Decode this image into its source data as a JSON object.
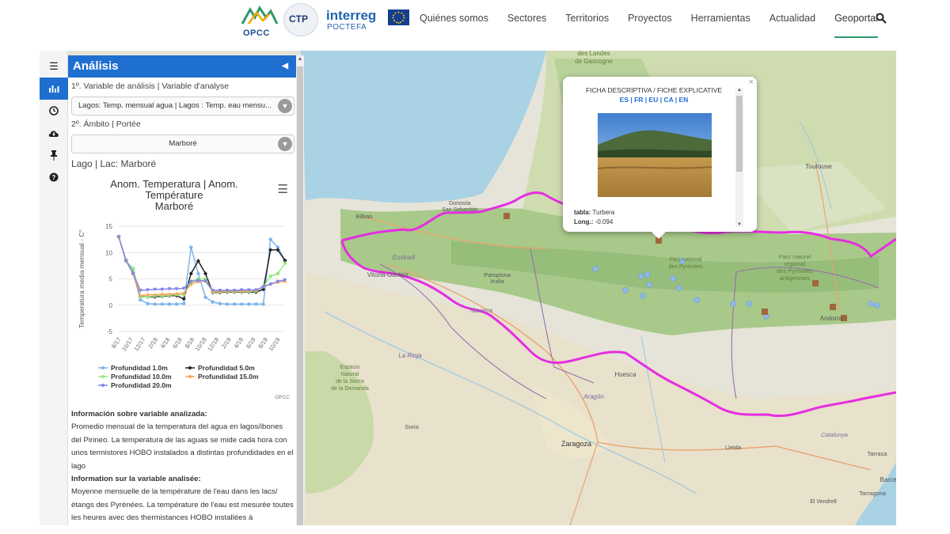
{
  "header": {
    "logos": {
      "opcc": "OPCC",
      "ctp": "CTP",
      "interreg": "interreg",
      "poctefa": "POCTEFA"
    },
    "nav": [
      {
        "label": "Quiénes somos"
      },
      {
        "label": "Sectores"
      },
      {
        "label": "Territorios"
      },
      {
        "label": "Proyectos"
      },
      {
        "label": "Herramientas"
      },
      {
        "label": "Actualidad"
      },
      {
        "label": "Geoportal",
        "active": true
      }
    ],
    "icons": {
      "search": "search-icon"
    }
  },
  "toolbar": {
    "tools": [
      {
        "icon": "menu-icon",
        "active": false
      },
      {
        "icon": "bar-chart-icon",
        "active": true
      },
      {
        "icon": "clock-icon",
        "active": false
      },
      {
        "icon": "cloud-download-icon",
        "active": false
      },
      {
        "icon": "pin-icon",
        "active": false
      },
      {
        "icon": "help-icon",
        "active": false
      }
    ]
  },
  "panel": {
    "title": "Análisis",
    "variable_label": "1º. Variable de análisis | Variable d'analyse",
    "variable_value": "Lagos: Temp. mensual agua | Lagos : Temp. eau mensu...",
    "scope_label": "2º. Ámbito | Portée",
    "scope_value": "Marboré",
    "lake_label": "Lago | Lac: Marboré",
    "info": {
      "es_title": "Información sobre variable analizada:",
      "es_text": "Promedio mensual de la temperatura del agua en lagos/ibones del Pirineo. La temperatura de las aguas se mide cada hora con unos termistores HOBO instalados a distintas profundidades en el lago",
      "fr_title": "Information sur la variable analisée:",
      "fr_text": "Moyenne mensuelle de la température de l'eau dans les lacs/ étangs des Pyrénées. La température de l'eau est mesurée toutes les heures avec des thermistances HOBO installées à"
    }
  },
  "chart_data": {
    "type": "line",
    "title_lines": [
      "Anom. Temperatura | Anom.",
      "Température",
      "Marboré"
    ],
    "ylabel": "Temperatura media mensual - C°",
    "ylim": [
      -5,
      15
    ],
    "yticks": [
      -5,
      0,
      5,
      10,
      15
    ],
    "x_tick_labels": [
      "8/17",
      "10/17",
      "12/17",
      "2/18",
      "4/18",
      "6/18",
      "8/18",
      "10/18",
      "12/18",
      "2/19",
      "4/19",
      "6/19",
      "8/19",
      "10/19"
    ],
    "credit": "OPCC",
    "legend_position": "bottom",
    "series": [
      {
        "name": "Profundidad 1.0m",
        "color": "#7cb5ec",
        "marker": "circle",
        "values": [
          13.0,
          8.4,
          6.5,
          1.0,
          0.3,
          0.2,
          0.2,
          0.2,
          0.2,
          0.3,
          11.0,
          6.0,
          1.5,
          0.6,
          0.3,
          0.2,
          0.2,
          0.2,
          0.2,
          0.2,
          0.2,
          12.5,
          11.0,
          8.5
        ]
      },
      {
        "name": "Profundidad 5.0m",
        "color": "#222222",
        "marker": "diamond",
        "values": [
          13.0,
          8.5,
          6.0,
          1.6,
          1.6,
          1.6,
          1.7,
          1.8,
          1.8,
          1.2,
          6.0,
          8.4,
          6.0,
          2.4,
          2.4,
          2.5,
          2.5,
          2.5,
          2.5,
          2.5,
          3.0,
          10.5,
          10.5,
          8.5
        ]
      },
      {
        "name": "Profundidad 10.0m",
        "color": "#90ed7d",
        "marker": "square",
        "values": [
          13.0,
          8.4,
          7.0,
          1.5,
          1.6,
          1.8,
          1.8,
          1.9,
          2.0,
          2.0,
          4.5,
          5.0,
          5.0,
          2.5,
          2.5,
          2.6,
          2.6,
          2.6,
          2.6,
          2.7,
          3.5,
          5.5,
          6.0,
          8.0
        ]
      },
      {
        "name": "Profundidad 15.0m",
        "color": "#f7a35c",
        "marker": "triangle",
        "values": [
          13.0,
          8.5,
          6.0,
          1.8,
          2.0,
          2.0,
          2.1,
          2.1,
          2.2,
          2.3,
          4.0,
          4.5,
          4.6,
          2.6,
          2.6,
          2.7,
          2.7,
          2.7,
          2.8,
          2.8,
          3.5,
          4.0,
          4.4,
          4.6
        ]
      },
      {
        "name": "Profundidad 20.0m",
        "color": "#8085e9",
        "marker": "triangle-down",
        "values": [
          13.0,
          8.5,
          6.0,
          2.8,
          2.9,
          3.0,
          3.0,
          3.1,
          3.1,
          3.2,
          4.5,
          4.7,
          4.6,
          2.8,
          2.8,
          2.8,
          2.8,
          2.9,
          2.9,
          2.9,
          3.5,
          4.0,
          4.5,
          4.8
        ]
      }
    ]
  },
  "map": {
    "places": [
      {
        "name": "des Landes\nde Gascogne",
        "type": "park"
      },
      {
        "name": "Toulouse",
        "type": "city"
      },
      {
        "name": "Bilbao",
        "type": "city"
      },
      {
        "name": "Donostia\nSan Sebastián",
        "type": "city"
      },
      {
        "name": "Vitoria-Gasteiz",
        "type": "city"
      },
      {
        "name": "Euskadi",
        "type": "region"
      },
      {
        "name": "Pamplona\nIruña",
        "type": "city"
      },
      {
        "name": "Navarra",
        "type": "region"
      },
      {
        "name": "La Rioja",
        "type": "region"
      },
      {
        "name": "Huesca",
        "type": "city"
      },
      {
        "name": "Zaragoza",
        "type": "city"
      },
      {
        "name": "Soria",
        "type": "city"
      },
      {
        "name": "Lleida",
        "type": "city"
      },
      {
        "name": "Andorra",
        "type": "city"
      },
      {
        "name": "Catalunya",
        "type": "region"
      },
      {
        "name": "Tarragona",
        "type": "city"
      },
      {
        "name": "Tarrasa",
        "type": "city"
      },
      {
        "name": "Barce",
        "type": "city"
      },
      {
        "name": "Parc naturel\nrégional\ndes Pyrénées\nariégeoises",
        "type": "park"
      },
      {
        "name": "Parc national\ndes Pyrénées",
        "type": "park"
      },
      {
        "name": "Espacio\nNatural\nde la Sierra\nde la Demanda",
        "type": "park"
      },
      {
        "name": "El Vendrell",
        "type": "city"
      },
      {
        "name": "Aragón",
        "type": "region"
      }
    ]
  },
  "popup": {
    "title": "FICHA DESCRIPTIVA / FICHE EXPLICATIVE",
    "langs": "ES | FR | EU | CA | EN",
    "tabla_key": "tabla:",
    "tabla_val": "Turbera",
    "long_key": "Long.:",
    "long_val": "-0.094",
    "close": "×"
  }
}
